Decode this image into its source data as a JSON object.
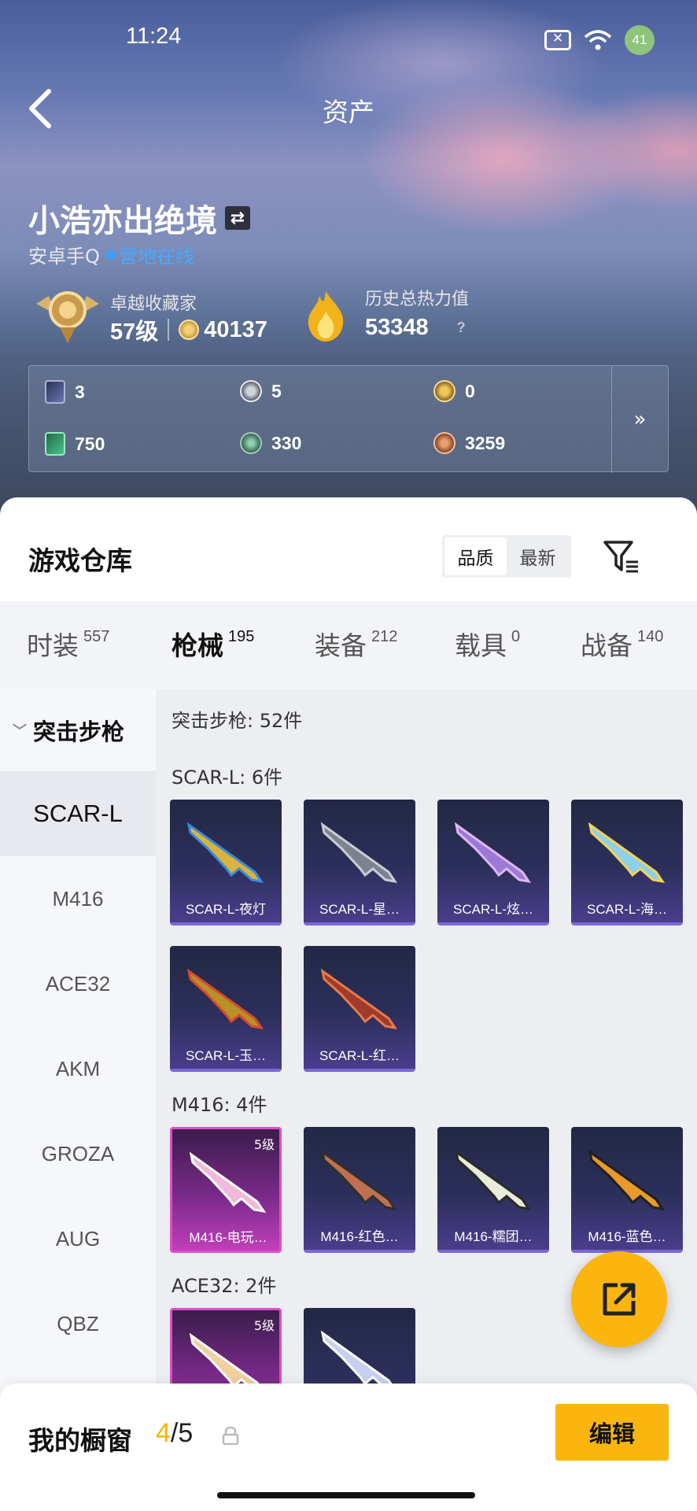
{
  "status_bar": {
    "time": "11:24",
    "battery": "41"
  },
  "header": {
    "title": "资产"
  },
  "player": {
    "name": "小浩亦出绝境",
    "platform": "安卓手Q",
    "online_status": "营地在线",
    "rank_title": "卓越收藏家",
    "rank_level": "57级",
    "rank_points": "40137",
    "heat_title": "历史总热力值",
    "heat_value": "53348",
    "heat_help": "?"
  },
  "currencies": [
    {
      "icon": "ticket-card-icon",
      "value": "3"
    },
    {
      "icon": "silver-token-icon",
      "value": "5"
    },
    {
      "icon": "gold-token-icon",
      "value": "0"
    },
    {
      "icon": "green-card-icon",
      "value": "750"
    },
    {
      "icon": "green-orb-icon",
      "value": "330"
    },
    {
      "icon": "bronze-coin-icon",
      "value": "3259"
    }
  ],
  "currency_more": "»",
  "warehouse": {
    "title": "游戏仓库",
    "sort_options": [
      "品质",
      "最新"
    ],
    "sort_active": "品质"
  },
  "tabs": [
    {
      "label": "时装",
      "count": "557"
    },
    {
      "label": "枪械",
      "count": "195"
    },
    {
      "label": "装备",
      "count": "212"
    },
    {
      "label": "载具",
      "count": "0"
    },
    {
      "label": "战备",
      "count": "140"
    }
  ],
  "side_nav": {
    "group": "突击步枪",
    "items": [
      "SCAR-L",
      "M416",
      "ACE32",
      "AKM",
      "GROZA",
      "AUG",
      "QBZ"
    ]
  },
  "content": {
    "header": "突击步枪: 52件",
    "groups": [
      {
        "title": "SCAR-L: 6件",
        "cards": [
          {
            "name": "SCAR-L-夜灯"
          },
          {
            "name": "SCAR-L-星…"
          },
          {
            "name": "SCAR-L-炫…"
          },
          {
            "name": "SCAR-L-海…"
          },
          {
            "name": "SCAR-L-玉…"
          },
          {
            "name": "SCAR-L-红…"
          }
        ]
      },
      {
        "title": "M416: 4件",
        "cards": [
          {
            "name": "M416-电玩…",
            "level": "5级"
          },
          {
            "name": "M416-红色…"
          },
          {
            "name": "M416-糯团…"
          },
          {
            "name": "M416-蓝色…"
          }
        ]
      },
      {
        "title": "ACE32: 2件",
        "cards": [
          {
            "name": "",
            "level": "5级"
          },
          {
            "name": ""
          }
        ]
      }
    ]
  },
  "showcase": {
    "label": "我的橱窗",
    "current": "4",
    "separator": "/",
    "total": "5",
    "edit_label": "编辑"
  }
}
